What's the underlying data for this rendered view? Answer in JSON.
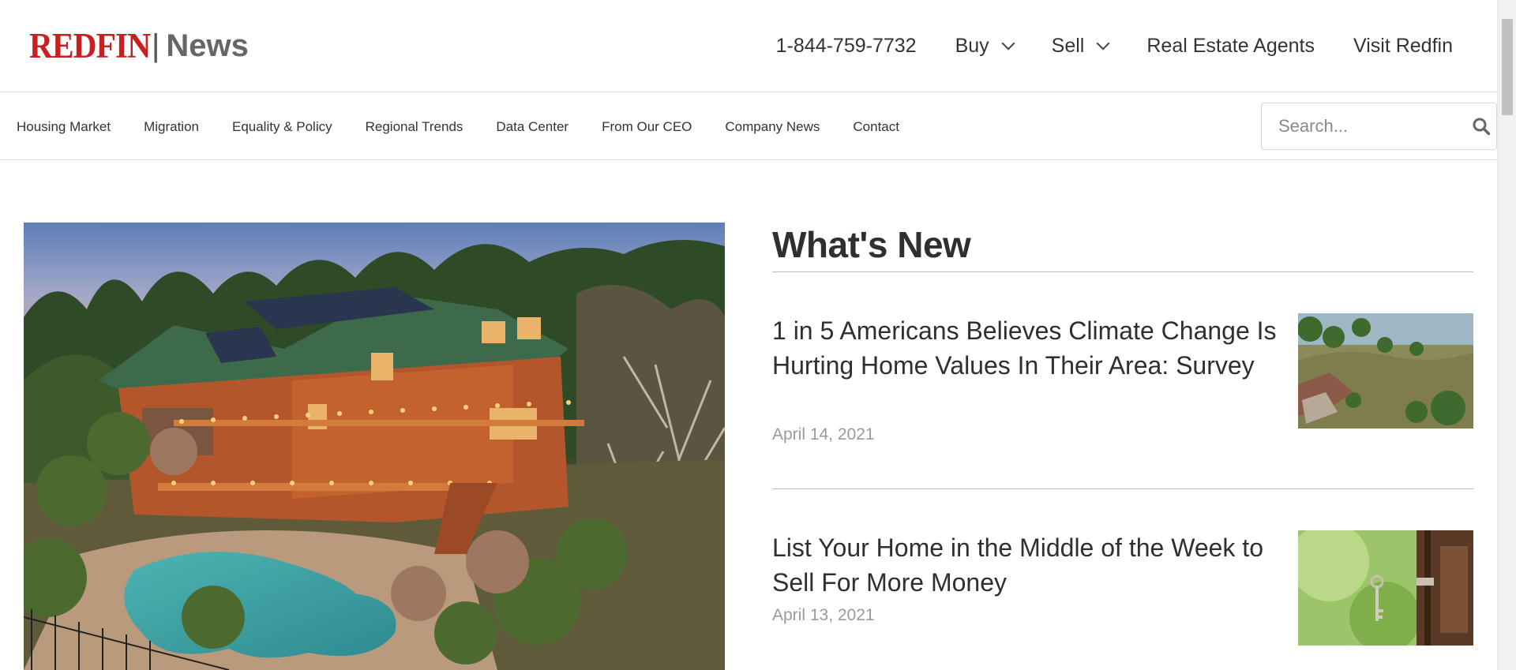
{
  "header": {
    "logo_brand": "REDFIN",
    "logo_section": "News",
    "phone": "1-844-759-7732",
    "nav": [
      {
        "label": "Buy"
      },
      {
        "label": "Sell"
      },
      {
        "label": "Real Estate Agents"
      },
      {
        "label": "Visit Redfin"
      }
    ]
  },
  "subnav": {
    "links": [
      "Housing Market",
      "Migration",
      "Equality & Policy",
      "Regional Trends",
      "Data Center",
      "From Our CEO",
      "Company News",
      "Contact"
    ],
    "search_placeholder": "Search..."
  },
  "main": {
    "section_title": "What's New",
    "articles": [
      {
        "title": "1 in 5 Americans Believes Climate Change Is Hurting Home Values In Their Area: Survey",
        "date": "April 14, 2021",
        "thumb": "flooded-neighborhood"
      },
      {
        "title": "List Your Home in the Middle of the Week to Sell For More Money",
        "date": "April 13, 2021",
        "thumb": "key-in-door"
      }
    ]
  },
  "icons": {
    "search": "search-icon",
    "chevron": "chevron-down-icon"
  },
  "colors": {
    "brand_red": "#c82021",
    "text": "#333333",
    "muted": "#9a9a9a",
    "divider": "#dcdcdc"
  }
}
